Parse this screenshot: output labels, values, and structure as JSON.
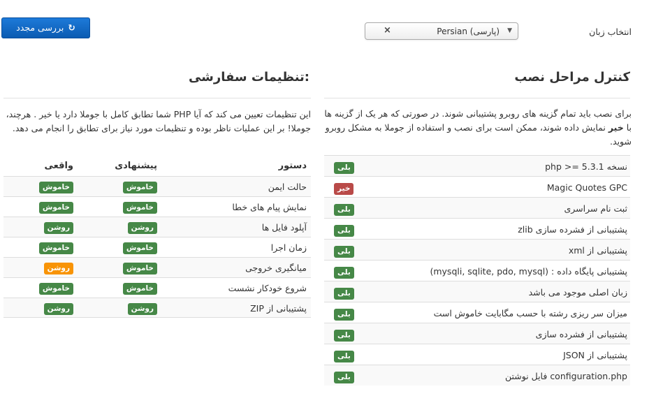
{
  "header": {
    "language_label": "انتخاب زبان",
    "language_value": "Persian (پارسی)",
    "clear_symbol": "×",
    "recheck_button": "بررسی مجدد",
    "recheck_icon": "↻"
  },
  "preinstall": {
    "title": "کنترل مراحل نصب",
    "desc_part1": "برای نصب باید تمام گزینه های روبرو پشتیبانی شوند. در صورتی که هر یک از گزینه ها با ",
    "desc_bold": "خیر",
    "desc_part2": " نمایش داده شوند، ممکن است برای نصب و استفاده از جوملا به مشکل روبرو شوید.",
    "items": [
      {
        "label": "نسخه php >= 5.3.1",
        "status": "بلی",
        "color": "#468847"
      },
      {
        "label": "Magic Quotes GPC",
        "status": "خیر",
        "color": "#b94a48"
      },
      {
        "label": "ثبت نام سراسری",
        "status": "بلی",
        "color": "#468847"
      },
      {
        "label": "پشتیبانی از فشرده سازی zlib",
        "status": "بلی",
        "color": "#468847"
      },
      {
        "label": "پشتیبانی از xml",
        "status": "بلی",
        "color": "#468847"
      },
      {
        "label": "پشتیبانی پایگاه داده : (mysqli, sqlite, pdo, mysql)",
        "status": "بلی",
        "color": "#468847"
      },
      {
        "label": "زبان اصلی موجود می باشد",
        "status": "بلی",
        "color": "#468847"
      },
      {
        "label": "میزان سر ریزی رشته با حسب مگابایت خاموش است",
        "status": "بلی",
        "color": "#468847"
      },
      {
        "label": "پشتیبانی از فشرده سازی",
        "status": "بلی",
        "color": "#468847"
      },
      {
        "label": "پشتیبانی از JSON",
        "status": "بلی",
        "color": "#468847"
      },
      {
        "label": "configuration.php فایل نوشتن",
        "status": "بلی",
        "color": "#468847"
      }
    ]
  },
  "recommended": {
    "title": "تنظیمات سفارشی:",
    "desc": "این تنظیمات تعیین می کند که آیا PHP شما تطابق کامل با جوملا دارد یا خیر . هرچند، جوملا! بر این عملیات ناظر بوده و تنظیمات مورد نیاز برای تطابق را انجام می دهد.",
    "headers": {
      "directive": "دستور",
      "recommended": "پیشنهادی",
      "actual": "واقعی"
    },
    "rows": [
      {
        "setting": "حالت ایمن",
        "recommended": "خاموش",
        "actual": "خاموش",
        "actual_color": "#468847"
      },
      {
        "setting": "نمایش پیام های خطا",
        "recommended": "خاموش",
        "actual": "خاموش",
        "actual_color": "#468847"
      },
      {
        "setting": "آپلود فایل ها",
        "recommended": "روشن",
        "actual": "روشن",
        "actual_color": "#468847"
      },
      {
        "setting": "زمان اجرا",
        "recommended": "خاموش",
        "actual": "خاموش",
        "actual_color": "#468847"
      },
      {
        "setting": "میانگیری خروجی",
        "recommended": "خاموش",
        "actual": "روشن",
        "actual_color": "#f89406"
      },
      {
        "setting": "شروع خودکار نشست",
        "recommended": "خاموش",
        "actual": "خاموش",
        "actual_color": "#468847"
      },
      {
        "setting": "پشتیبانی از ZIP",
        "recommended": "روشن",
        "actual": "روشن",
        "actual_color": "#468847"
      }
    ]
  }
}
